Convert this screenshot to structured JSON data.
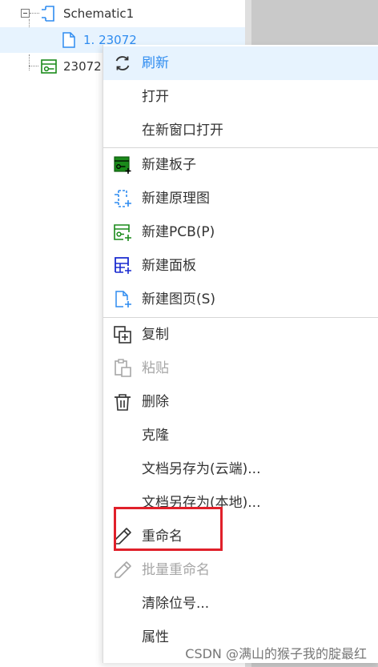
{
  "tree": {
    "items": [
      {
        "label": "Schematic1",
        "icon": "schematic-icon"
      },
      {
        "label": "1. 23072",
        "icon": "page-icon"
      },
      {
        "label": "23072",
        "icon": "pcb-icon"
      }
    ]
  },
  "menu": {
    "items": [
      {
        "label": "刷新",
        "icon": "refresh-icon"
      },
      {
        "label": "打开"
      },
      {
        "label": "在新窗口打开"
      },
      {
        "label": "新建板子",
        "icon": "new-board-icon"
      },
      {
        "label": "新建原理图",
        "icon": "new-schematic-icon"
      },
      {
        "label": "新建PCB(P)",
        "icon": "new-pcb-icon"
      },
      {
        "label": "新建面板",
        "icon": "new-panel-icon"
      },
      {
        "label": "新建图页(S)",
        "icon": "new-page-icon"
      },
      {
        "label": "复制",
        "icon": "copy-icon"
      },
      {
        "label": "粘贴",
        "icon": "paste-icon"
      },
      {
        "label": "删除",
        "icon": "trash-icon"
      },
      {
        "label": "克隆"
      },
      {
        "label": "文档另存为(云端)..."
      },
      {
        "label": "文档另存为(本地)..."
      },
      {
        "label": "重命名",
        "icon": "pencil-icon"
      },
      {
        "label": "批量重命名",
        "icon": "pencil-icon"
      },
      {
        "label": "清除位号..."
      },
      {
        "label": "属性"
      }
    ]
  },
  "colors": {
    "accent": "#2f8cf0",
    "hover_bg": "#e7f3fe",
    "disabled": "#a6a6a6",
    "highlight": "#e0202a",
    "green": "#1a8a1a"
  },
  "watermark": "CSDN @满山的猴子我的腚最红"
}
